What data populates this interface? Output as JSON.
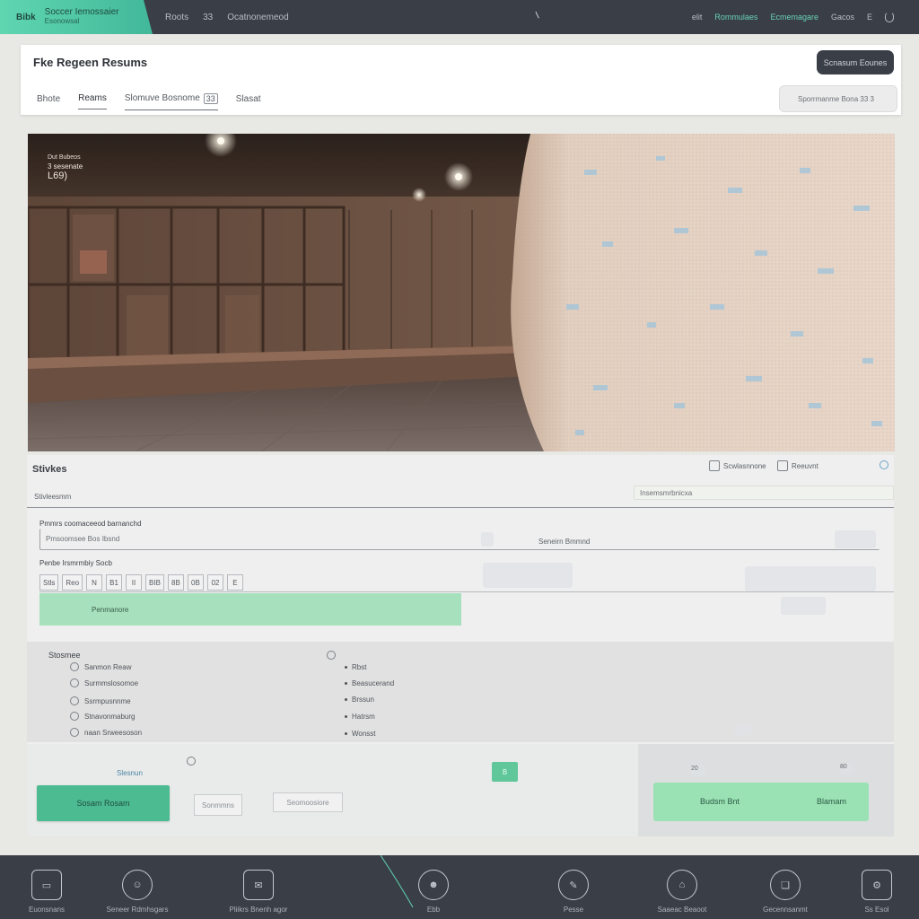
{
  "topbar": {
    "logo_text": "Bibk",
    "brand_name": "Soccer Iemossaier",
    "brand_sub": "Esonowsal",
    "nav": [
      "Roots",
      "33",
      "Ocatnonemeod"
    ],
    "right_links": [
      "elit",
      "Rommulaes",
      "Ecmemagare",
      "Gacos",
      "E"
    ],
    "accent": "#5fd6b0"
  },
  "header": {
    "title": "Fke Regeen Resums",
    "button_label": "Scnasum Eounes",
    "tabs": [
      "Bhote",
      "Reams",
      "Slomuve Bosnome",
      "33",
      "Slasat"
    ],
    "search_placeholder": "Sporrmanme Bona 33 3"
  },
  "hero": {
    "caption_line1": "Dut Bubeos",
    "caption_line2": "3 sesenate",
    "caption_line3": "L69)"
  },
  "settings": {
    "title": "Stivkes",
    "subtitle": "Stivleesmm",
    "status_a": "Scwlasnnone",
    "status_b": "Reeuvnt",
    "top_right_field": "Insemsmrbnicxa",
    "form_label_1": "Pmmrs coomaceeod barnanchd",
    "form_field_1_value": "Pmsoomsee Bos Ibsnd",
    "form_field_1_sub": "Seneirn Bmmnd",
    "form_label_2": "Penbe Irsmrmbiy Socb",
    "toolbar": [
      "Stls",
      "Reo",
      "N",
      "B1",
      "II",
      "BIB",
      "8B",
      "0B",
      "02",
      "E"
    ],
    "green_bar_label": "Penmanore"
  },
  "status": {
    "title": "Stosmee",
    "rows": [
      {
        "label": "Sanmon Reaw",
        "value": "Rbst"
      },
      {
        "label": "Surmmslosomoe",
        "value": "Beasucerand"
      },
      {
        "label": "Ssrmpusnnme",
        "value": "Brssun"
      },
      {
        "label": "Stnavonmaburg",
        "value": "Hatrsm"
      },
      {
        "label": "naan Srweesoson",
        "value": "Wonsst"
      }
    ]
  },
  "actions": {
    "label": "Slesnun",
    "primary_button": "Sosam Rosam",
    "field_a": "Sonmmns",
    "field_b": "Seomoosiore",
    "green_square": "B",
    "secondary_button_left": "Budsm Bnt",
    "secondary_button_right": "Blamam",
    "badge_a": "20",
    "badge_b": "80"
  },
  "dock": {
    "items": [
      {
        "label": "Euonsnans",
        "icon": "wallet-icon"
      },
      {
        "label": "Seneer Rdmhsgars",
        "icon": "chat-icon"
      },
      {
        "label": "Pliikrs Bnenh agor",
        "icon": "mail-icon"
      },
      {
        "label": "Ebb",
        "icon": "user-icon"
      },
      {
        "label": "Pesse",
        "icon": "feather-icon"
      },
      {
        "label": "Saaeac Beaoot",
        "icon": "lock-icon"
      },
      {
        "label": "Gecennsanmt",
        "icon": "gift-icon"
      },
      {
        "label": "Ss Esol",
        "icon": "settings-icon"
      }
    ]
  }
}
